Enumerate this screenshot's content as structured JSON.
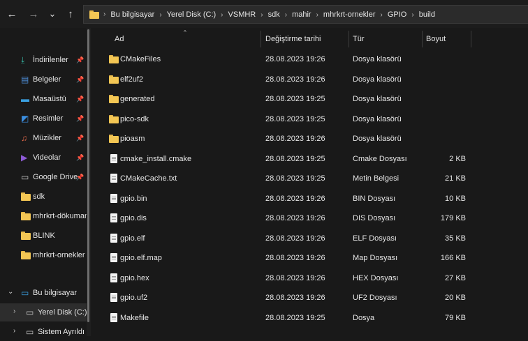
{
  "nav": {
    "back_glyph": "←",
    "forward_glyph": "→",
    "dropdown_glyph": "⌄",
    "up_glyph": "↑"
  },
  "address": {
    "crumbs": [
      "Bu bilgisayar",
      "Yerel Disk (C:)",
      "VSMHR",
      "sdk",
      "mahir",
      "mhrkrt-ornekler",
      "GPIO",
      "build"
    ],
    "separator": "›"
  },
  "sidebar": {
    "quick_access": [
      {
        "label": "İndirilenler",
        "icon": "download-icon",
        "pinned": true
      },
      {
        "label": "Belgeler",
        "icon": "documents-icon",
        "pinned": true
      },
      {
        "label": "Masaüstü",
        "icon": "desktop-icon",
        "pinned": true
      },
      {
        "label": "Resimler",
        "icon": "pictures-icon",
        "pinned": true
      },
      {
        "label": "Müzikler",
        "icon": "music-icon",
        "pinned": true
      },
      {
        "label": "Videolar",
        "icon": "videos-icon",
        "pinned": true
      },
      {
        "label": "Google Drive",
        "icon": "drive-icon",
        "pinned": true
      },
      {
        "label": "sdk",
        "icon": "folder-icon",
        "pinned": false
      },
      {
        "label": "mhrkrt-dökuman",
        "icon": "folder-icon",
        "pinned": false
      },
      {
        "label": "BLINK",
        "icon": "folder-icon",
        "pinned": false
      },
      {
        "label": "mhrkrt-ornekler",
        "icon": "folder-icon",
        "pinned": false
      }
    ],
    "this_pc": {
      "label": "Bu bilgisayar",
      "icon": "computer-icon"
    },
    "drives": [
      {
        "label": "Yerel Disk (C:)",
        "icon": "drive-c-icon",
        "selected": true
      },
      {
        "label": "Sistem Ayrıldı",
        "icon": "drive-icon",
        "selected": false
      }
    ],
    "pin_glyph": "📌"
  },
  "columns": {
    "name": "Ad",
    "date": "Değiştirme tarihi",
    "type": "Tür",
    "size": "Boyut",
    "sort_glyph": "^"
  },
  "files": [
    {
      "name": "CMakeFiles",
      "date": "28.08.2023 19:26",
      "type": "Dosya klasörü",
      "size": "",
      "kind": "folder"
    },
    {
      "name": "elf2uf2",
      "date": "28.08.2023 19:26",
      "type": "Dosya klasörü",
      "size": "",
      "kind": "folder"
    },
    {
      "name": "generated",
      "date": "28.08.2023 19:25",
      "type": "Dosya klasörü",
      "size": "",
      "kind": "folder"
    },
    {
      "name": "pico-sdk",
      "date": "28.08.2023 19:25",
      "type": "Dosya klasörü",
      "size": "",
      "kind": "folder"
    },
    {
      "name": "pioasm",
      "date": "28.08.2023 19:26",
      "type": "Dosya klasörü",
      "size": "",
      "kind": "folder"
    },
    {
      "name": "cmake_install.cmake",
      "date": "28.08.2023 19:25",
      "type": "Cmake Dosyası",
      "size": "2 KB",
      "kind": "file"
    },
    {
      "name": "CMakeCache.txt",
      "date": "28.08.2023 19:25",
      "type": "Metin Belgesi",
      "size": "21 KB",
      "kind": "file"
    },
    {
      "name": "gpio.bin",
      "date": "28.08.2023 19:26",
      "type": "BIN Dosyası",
      "size": "10 KB",
      "kind": "file"
    },
    {
      "name": "gpio.dis",
      "date": "28.08.2023 19:26",
      "type": "DIS Dosyası",
      "size": "179 KB",
      "kind": "file"
    },
    {
      "name": "gpio.elf",
      "date": "28.08.2023 19:26",
      "type": "ELF Dosyası",
      "size": "35 KB",
      "kind": "file"
    },
    {
      "name": "gpio.elf.map",
      "date": "28.08.2023 19:26",
      "type": "Map Dosyası",
      "size": "166 KB",
      "kind": "file"
    },
    {
      "name": "gpio.hex",
      "date": "28.08.2023 19:26",
      "type": "HEX Dosyası",
      "size": "27 KB",
      "kind": "file"
    },
    {
      "name": "gpio.uf2",
      "date": "28.08.2023 19:26",
      "type": "UF2 Dosyası",
      "size": "20 KB",
      "kind": "file"
    },
    {
      "name": "Makefile",
      "date": "28.08.2023 19:25",
      "type": "Dosya",
      "size": "79 KB",
      "kind": "file"
    }
  ],
  "colors": {
    "background": "#191919",
    "folder": "#f3c654",
    "accent": "#35b3a1"
  }
}
